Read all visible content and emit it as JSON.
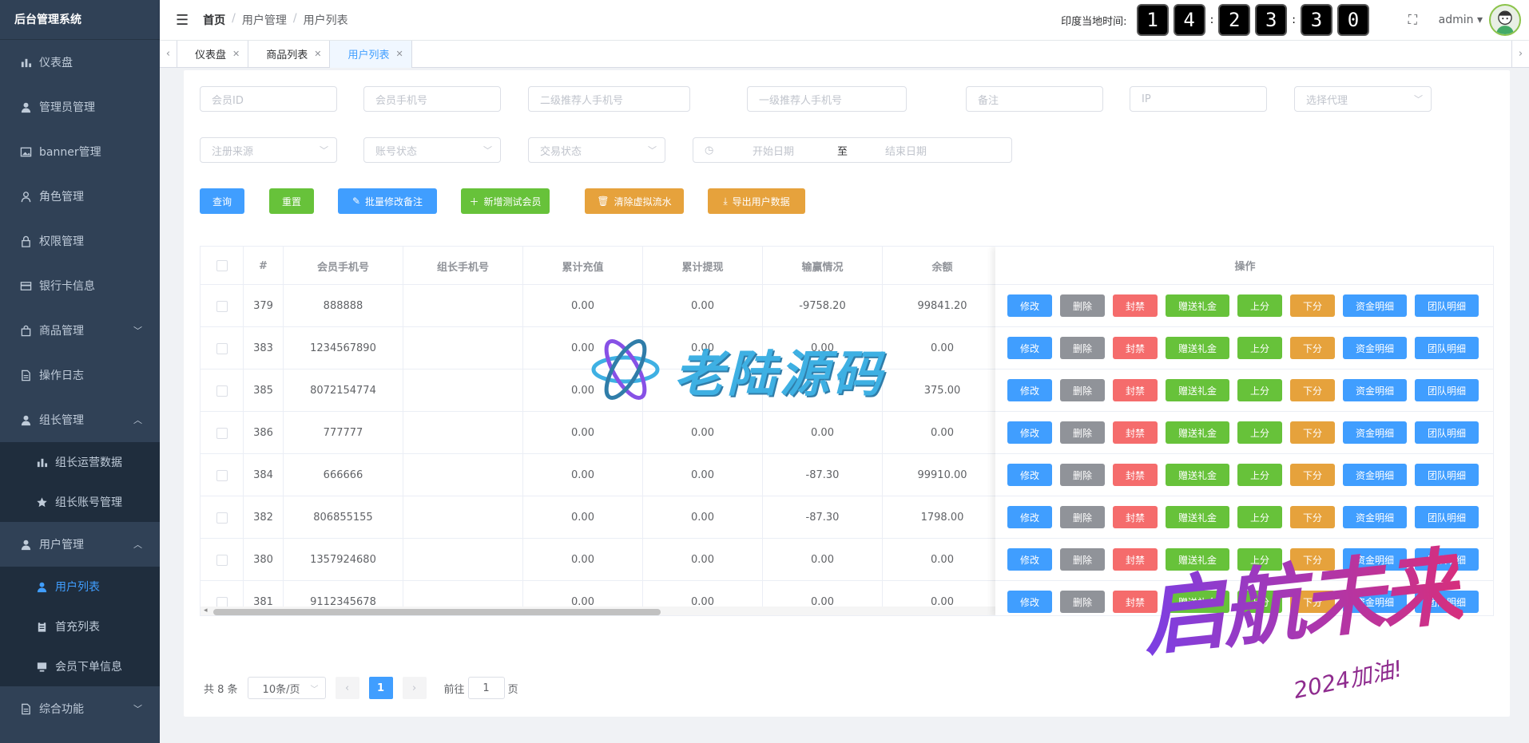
{
  "app": {
    "title": "后台管理系统"
  },
  "sidebar": {
    "items": [
      {
        "label": "仪表盘"
      },
      {
        "label": "管理员管理"
      },
      {
        "label": "banner管理"
      },
      {
        "label": "角色管理"
      },
      {
        "label": "权限管理"
      },
      {
        "label": "银行卡信息"
      },
      {
        "label": "商品管理"
      },
      {
        "label": "操作日志"
      },
      {
        "label": "组长管理"
      },
      {
        "label": "组长运营数据"
      },
      {
        "label": "组长账号管理"
      },
      {
        "label": "用户管理"
      },
      {
        "label": "用户列表"
      },
      {
        "label": "首充列表"
      },
      {
        "label": "会员下单信息"
      },
      {
        "label": "综合功能"
      }
    ]
  },
  "header": {
    "breadcrumb": [
      "首页",
      "用户管理",
      "用户列表"
    ],
    "clock_label": "印度当地时间:",
    "clock_digits": [
      "1",
      "4",
      "2",
      "3",
      "3",
      "0"
    ],
    "user": "admin"
  },
  "tabs": [
    {
      "label": "仪表盘"
    },
    {
      "label": "商品列表"
    },
    {
      "label": "用户列表"
    }
  ],
  "filters": {
    "member_id": "会员ID",
    "member_phone": "会员手机号",
    "second_referrer": "二级推荐人手机号",
    "first_referrer": "一级推荐人手机号",
    "remark": "备注",
    "ip": "IP",
    "agent": "选择代理",
    "reg_source": "注册来源",
    "account_status": "账号状态",
    "trade_status": "交易状态",
    "start_date": "开始日期",
    "date_sep": "至",
    "end_date": "结束日期"
  },
  "actions": {
    "query": "查询",
    "reset": "重置",
    "batch_remark": "批量修改备注",
    "add_test": "新增测试会员",
    "clear_flow": "清除虚拟流水",
    "export": "导出用户数据"
  },
  "table": {
    "headers": [
      "#",
      "会员手机号",
      "组长手机号",
      "累计充值",
      "累计提现",
      "输赢情况",
      "余额",
      "操作"
    ],
    "rows": [
      {
        "id": "379",
        "phone": "888888",
        "leader": "",
        "recharge": "0.00",
        "withdraw": "0.00",
        "winloss": "-9758.20",
        "balance": "99841.20"
      },
      {
        "id": "383",
        "phone": "1234567890",
        "leader": "",
        "recharge": "0.00",
        "withdraw": "0.00",
        "winloss": "0.00",
        "balance": "0.00"
      },
      {
        "id": "385",
        "phone": "8072154774",
        "leader": "",
        "recharge": "0.00",
        "withdraw": "",
        "winloss": "",
        "balance": "375.00"
      },
      {
        "id": "386",
        "phone": "777777",
        "leader": "",
        "recharge": "0.00",
        "withdraw": "0.00",
        "winloss": "0.00",
        "balance": "0.00"
      },
      {
        "id": "384",
        "phone": "666666",
        "leader": "",
        "recharge": "0.00",
        "withdraw": "0.00",
        "winloss": "-87.30",
        "balance": "99910.00"
      },
      {
        "id": "382",
        "phone": "806855155",
        "leader": "",
        "recharge": "0.00",
        "withdraw": "0.00",
        "winloss": "-87.30",
        "balance": "1798.00"
      },
      {
        "id": "380",
        "phone": "1357924680",
        "leader": "",
        "recharge": "0.00",
        "withdraw": "0.00",
        "winloss": "0.00",
        "balance": "0.00"
      },
      {
        "id": "381",
        "phone": "9112345678",
        "leader": "",
        "recharge": "0.00",
        "withdraw": "0.00",
        "winloss": "0.00",
        "balance": "0.00"
      }
    ],
    "row_ops": [
      "修改",
      "删除",
      "封禁",
      "赠送礼金",
      "上分",
      "下分",
      "资金明细",
      "团队明细"
    ]
  },
  "pagination": {
    "total": "共 8 条",
    "page_size": "10条/页",
    "current": "1",
    "goto_label": "前往",
    "goto_value": "1",
    "page_suffix": "页"
  },
  "watermarks": {
    "brand": "老陆源码",
    "slogan": "启航未来",
    "slogan_sub": "2024加油!"
  },
  "colors": {
    "primary": "#409eff",
    "success": "#67c23a",
    "warning": "#e6a23c",
    "danger": "#f56c6c",
    "info": "#909399",
    "sidebar": "#304156"
  }
}
